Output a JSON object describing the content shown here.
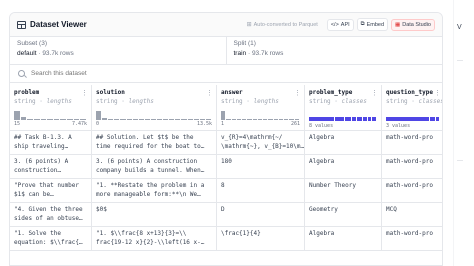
{
  "header": {
    "title": "Dataset Viewer",
    "auto_converted": "Auto-converted to Parquet",
    "api_label": "API",
    "embed_label": "Embed",
    "studio_label": "Data Studio"
  },
  "subset": {
    "label": "Subset (3)",
    "value": "default",
    "rows": "· 93.7k rows"
  },
  "split": {
    "label": "Split (1)",
    "value": "train",
    "rows": "· 93.7k rows"
  },
  "search": {
    "placeholder": "Search this dataset"
  },
  "columns": [
    {
      "name": "problem",
      "dtype": "string",
      "stat": "lengths",
      "min": "15",
      "max": "7.47k",
      "hist": [
        100,
        30,
        12,
        8,
        6,
        6,
        6,
        6,
        6,
        6,
        6
      ]
    },
    {
      "name": "solution",
      "dtype": "string",
      "stat": "lengths",
      "min": "0",
      "max": "13.5k",
      "hist": [
        100,
        20,
        8,
        6,
        6,
        6,
        6,
        6,
        6,
        6,
        6,
        6,
        6,
        6,
        6,
        6,
        6,
        6,
        6
      ]
    },
    {
      "name": "answer",
      "dtype": "string",
      "stat": "lengths",
      "min": "1",
      "max": "261",
      "hist": [
        100,
        8,
        6,
        6,
        6,
        6,
        6,
        6,
        6,
        6,
        6,
        6,
        6,
        6,
        6
      ]
    },
    {
      "name": "problem_type",
      "dtype": "string",
      "stat": "classes",
      "classes_label": "8 values",
      "class_shares": [
        42,
        14,
        10,
        8,
        8,
        6,
        6,
        6
      ]
    },
    {
      "name": "question_type",
      "dtype": "string",
      "stat": "classes",
      "classes_label": "3 values",
      "class_shares": [
        85,
        10,
        5
      ]
    }
  ],
  "rows": [
    {
      "problem": [
        "## Task B-1.3. A",
        "ship traveling…"
      ],
      "solution": [
        "## Solution. Let $t$ be the",
        "time required for the boat to…"
      ],
      "answer": [
        "v_{R}=4\\mathrm{~/",
        "\\mathrm{~}, v_{B}=10\\m…"
      ],
      "problem_type": [
        "Algebra"
      ],
      "question_type": [
        "math-word-pro"
      ]
    },
    {
      "problem": [
        "3. (6 points) A",
        "construction…"
      ],
      "solution": [
        "3. (6 points) A construction",
        "company builds a tunnel. When…"
      ],
      "answer": [
        "180"
      ],
      "problem_type": [
        "Algebra"
      ],
      "question_type": [
        "math-word-pro"
      ]
    },
    {
      "problem": [
        "\"Prove that number",
        "$1$ can be…"
      ],
      "solution": [
        "\"1. **Restate the problem in a",
        "more manageable form:**\\n We…"
      ],
      "answer": [
        "8"
      ],
      "problem_type": [
        "Number Theory"
      ],
      "question_type": [
        "math-word-pro"
      ]
    },
    {
      "problem": [
        "\"4. Given the three",
        "sides of an obtuse…"
      ],
      "solution": [
        "$0$"
      ],
      "answer": [
        "D"
      ],
      "problem_type": [
        "Geometry"
      ],
      "question_type": [
        "MCQ"
      ]
    },
    {
      "problem": [
        "\"1. Solve the",
        "equation: $\\\\frac{…"
      ],
      "solution": [
        "\"1. $\\\\frac{8 x+13}{3}=\\\\",
        "frac{19-12 x}{2}-\\\\left(16 x-…"
      ],
      "answer": [
        "\\frac{1}{4}"
      ],
      "problem_type": [
        "Algebra"
      ],
      "question_type": [
        "math-word-pro"
      ]
    }
  ],
  "right_panel": {
    "partial_text": "V"
  }
}
